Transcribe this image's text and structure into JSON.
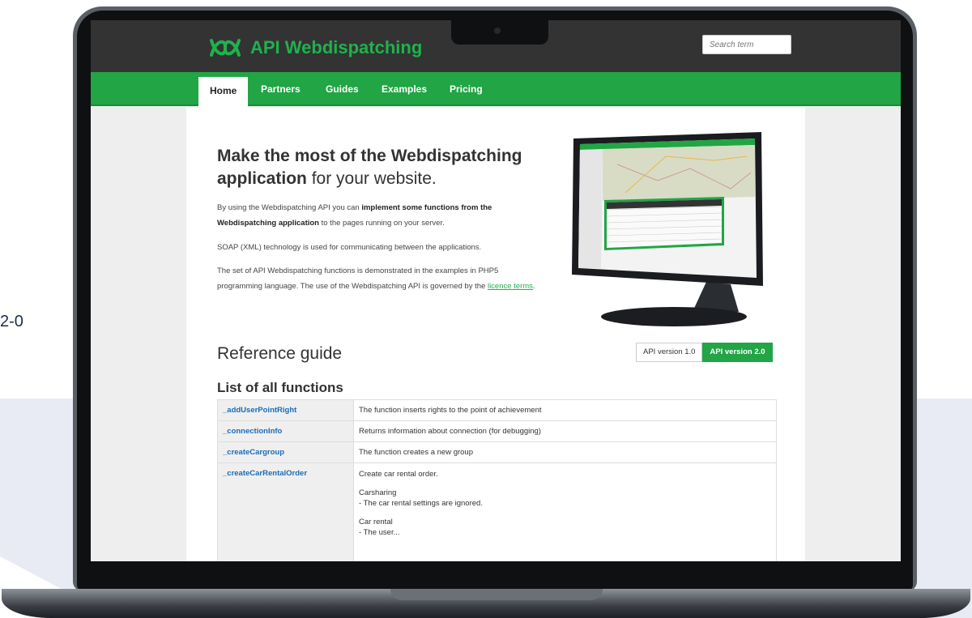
{
  "side_text": "2-0",
  "site": {
    "logo_text": "API Webdispatching",
    "search_placeholder": "Search term"
  },
  "nav": [
    {
      "label": "Home",
      "active": true
    },
    {
      "label": "Partners"
    },
    {
      "label": "Guides"
    },
    {
      "label": "Examples"
    },
    {
      "label": "Pricing"
    }
  ],
  "hero": {
    "title_bold": "Make the most of the Webdispatching application",
    "title_rest": " for your website."
  },
  "intro": {
    "p1_a": "By using the Webdispatching API you can ",
    "p1_b": "implement some functions from the Webdispatching application",
    "p1_c": " to the pages running on your server.",
    "p2": "SOAP (XML) technology is used for communicating between the applications.",
    "p3_a": "The set of API Webdispatching functions is demonstrated in the examples in PHP5 programming language. The use of the Webdispatching API is governed by the ",
    "p3_link": "licence terms",
    "p3_end": "."
  },
  "reference": {
    "title": "Reference guide",
    "versions": [
      {
        "label": "API version 1.0",
        "active": false
      },
      {
        "label": "API version 2.0",
        "active": true
      }
    ],
    "list_title": "List of all functions",
    "functions": [
      {
        "name": "_addUserPointRight",
        "desc": "The function inserts rights to the point of achievement"
      },
      {
        "name": "_connectionInfo",
        "desc": "Returns information about connection (for debugging)"
      },
      {
        "name": "_createCargroup",
        "desc": "The function creates a new group"
      },
      {
        "name": "_createCarRentalOrder",
        "desc_lines": [
          "Create car rental order.",
          "",
          "Carsharing",
          "- The car rental settings are ignored.",
          "",
          "Car rental",
          "- The user..."
        ]
      }
    ]
  },
  "colors": {
    "brand_green": "#21a545",
    "logo_green": "#1fb24c",
    "link_blue": "#1c6bb5",
    "topbar": "#333333"
  }
}
